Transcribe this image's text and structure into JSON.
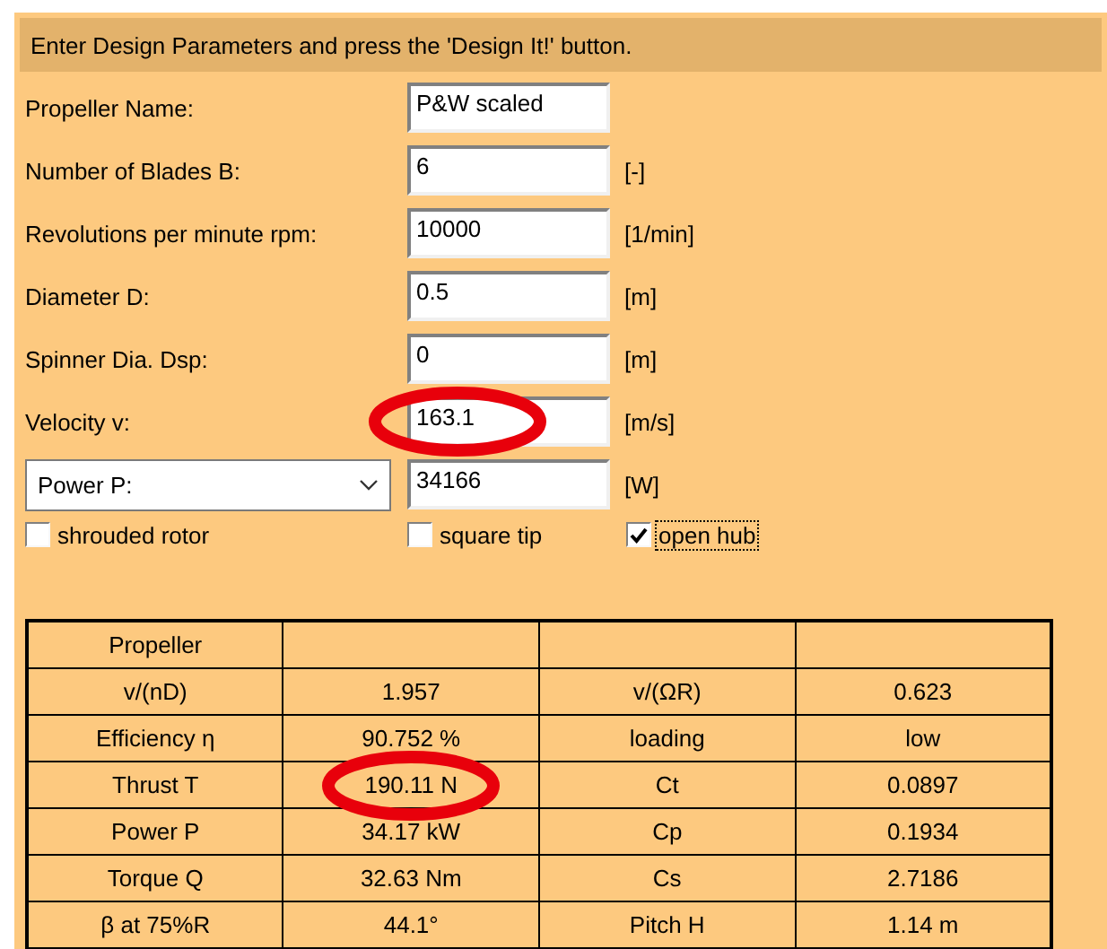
{
  "header": {
    "text": "Enter Design Parameters and press the 'Design It!' button."
  },
  "fields": [
    {
      "kind": "label",
      "label": "Propeller Name:",
      "value": "P&W scaled",
      "circled": false
    },
    {
      "kind": "label",
      "label": "Number of Blades  B:",
      "value": "6",
      "unit": "[-]",
      "circled": false
    },
    {
      "kind": "label",
      "label": "Revolutions per minute  rpm:",
      "value": "10000",
      "unit": "[1/min]",
      "circled": false
    },
    {
      "kind": "label",
      "label": "Diameter  D:",
      "value": "0.5",
      "unit": "[m]",
      "circled": false
    },
    {
      "kind": "label",
      "label": "Spinner Dia.  Dsp:",
      "value": "0",
      "unit": "[m]",
      "circled": false
    },
    {
      "kind": "label",
      "label": "Velocity  v:",
      "value": "163.1",
      "unit": "[m/s]",
      "circled": true
    },
    {
      "kind": "select",
      "label": "Power  P:",
      "value": "34166",
      "unit": "[W]",
      "circled": false
    }
  ],
  "checkboxes": [
    {
      "label": "shrouded rotor",
      "checked": false,
      "focused": false
    },
    {
      "label": "square tip",
      "checked": false,
      "focused": false
    },
    {
      "label": "open hub",
      "checked": true,
      "focused": true
    }
  ],
  "table": {
    "rows": [
      {
        "cells": [
          {
            "text": "Propeller",
            "circled": false
          }
        ]
      },
      {
        "cells": [
          {
            "text": "v/(nD)",
            "circled": false
          },
          {
            "text": "1.957",
            "circled": false
          },
          {
            "text": "v/(ΩR)",
            "circled": false
          },
          {
            "text": "0.623",
            "circled": false
          }
        ]
      },
      {
        "cells": [
          {
            "text": "Efficiency η",
            "circled": false
          },
          {
            "text": "90.752 %",
            "circled": false
          },
          {
            "text": "loading",
            "circled": false
          },
          {
            "text": "low",
            "circled": false
          }
        ]
      },
      {
        "cells": [
          {
            "text": "Thrust  T",
            "circled": false
          },
          {
            "text": "190.11 N",
            "circled": true
          },
          {
            "text": "Ct",
            "circled": false
          },
          {
            "text": "0.0897",
            "circled": false
          }
        ]
      },
      {
        "cells": [
          {
            "text": "Power  P",
            "circled": false
          },
          {
            "text": "34.17 kW",
            "circled": false
          },
          {
            "text": "Cp",
            "circled": false
          },
          {
            "text": "0.1934",
            "circled": false
          }
        ]
      },
      {
        "cells": [
          {
            "text": "Torque  Q",
            "circled": false
          },
          {
            "text": "32.63 Nm",
            "circled": false
          },
          {
            "text": "Cs",
            "circled": false
          },
          {
            "text": "2.7186",
            "circled": false
          }
        ]
      },
      {
        "cells": [
          {
            "text": "β at 75%R",
            "circled": false
          },
          {
            "text": "44.1°",
            "circled": false
          },
          {
            "text": "Pitch H",
            "circled": false
          },
          {
            "text": "1.14 m",
            "circled": false
          }
        ]
      }
    ]
  }
}
